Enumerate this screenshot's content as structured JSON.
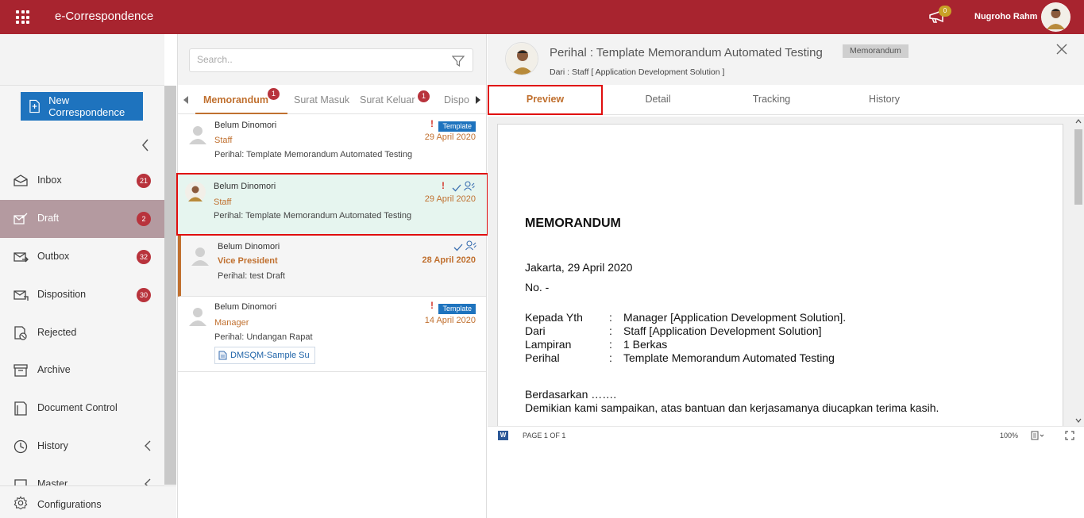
{
  "header": {
    "app_title": "e-Correspondence",
    "notification_count": "0",
    "user_name": "Nugroho Rahm"
  },
  "sidebar": {
    "new_button_label": "New Correspondence",
    "items": [
      {
        "label": "Inbox",
        "count": "21",
        "icon": "inbox-icon"
      },
      {
        "label": "Draft",
        "count": "2",
        "icon": "draft-icon",
        "active": true
      },
      {
        "label": "Outbox",
        "count": "32",
        "icon": "outbox-icon"
      },
      {
        "label": "Disposition",
        "count": "30",
        "icon": "disposition-icon"
      },
      {
        "label": "Rejected",
        "icon": "rejected-icon"
      },
      {
        "label": "Archive",
        "icon": "archive-icon"
      },
      {
        "label": "Document Control",
        "icon": "document-control-icon"
      },
      {
        "label": "History",
        "icon": "history-icon"
      },
      {
        "label": "Master",
        "icon": "master-icon"
      }
    ],
    "config_label": "Configurations"
  },
  "list": {
    "search_placeholder": "Search..",
    "tabs": [
      {
        "label": "Memorandum",
        "badge": "1"
      },
      {
        "label": "Surat Masuk"
      },
      {
        "label": "Surat Keluar",
        "badge": "1"
      },
      {
        "label": "Dispo"
      }
    ],
    "items": [
      {
        "sender": "Belum Dinomori",
        "role": "Staff",
        "subject": "Perihal: Template Memorandum Automated Testing",
        "date": "29 April 2020",
        "tag": "Template",
        "important": "!"
      },
      {
        "sender": "Belum Dinomori",
        "role": "Staff",
        "subject": "Perihal: Template Memorandum Automated Testing",
        "date": "29 April 2020",
        "important": "!"
      },
      {
        "sender": "Belum Dinomori",
        "role": "Vice President",
        "subject": "Perihal: test Draft",
        "date": "28 April 2020"
      },
      {
        "sender": "Belum Dinomori",
        "role": "Manager",
        "subject": "Perihal: Undangan Rapat",
        "date": "14 April 2020",
        "tag": "Template",
        "important": "!",
        "attachment": "DMSQM-Sample Su"
      }
    ]
  },
  "detail": {
    "title": "Perihal : Template Memorandum Automated Testing",
    "type_tag": "Memorandum",
    "from": "Dari : Staff [ Application Development Solution ]",
    "tabs": [
      "Preview",
      "Detail",
      "Tracking",
      "History"
    ],
    "document": {
      "heading": "MEMORANDUM",
      "place_date": "Jakarta, 29 April 2020",
      "number": "No. -",
      "fields": [
        {
          "key": "Kepada Yth",
          "colon": ":",
          "value": "Manager [Application Development Solution]."
        },
        {
          "key": "Dari",
          "colon": ":",
          "value": "Staff [Application Development Solution]"
        },
        {
          "key": "Lampiran",
          "colon": ":",
          "value": "1 Berkas"
        },
        {
          "key": "Perihal",
          "colon": ":",
          "value": "Template Memorandum Automated Testing"
        }
      ],
      "body_1": "Berdasarkan …….",
      "body_2": "Demikian kami sampaikan, atas bantuan dan kerjasamanya diucapkan terima kasih."
    },
    "viewer": {
      "word_badge": "W",
      "page_indicator": "PAGE 1 OF 1",
      "zoom": "100%"
    }
  },
  "colors": {
    "brand_red": "#a8242f",
    "accent_orange": "#c0702f",
    "badge_red": "#b8333c",
    "button_blue": "#1e73be",
    "highlight_red": "#e00e0e"
  }
}
